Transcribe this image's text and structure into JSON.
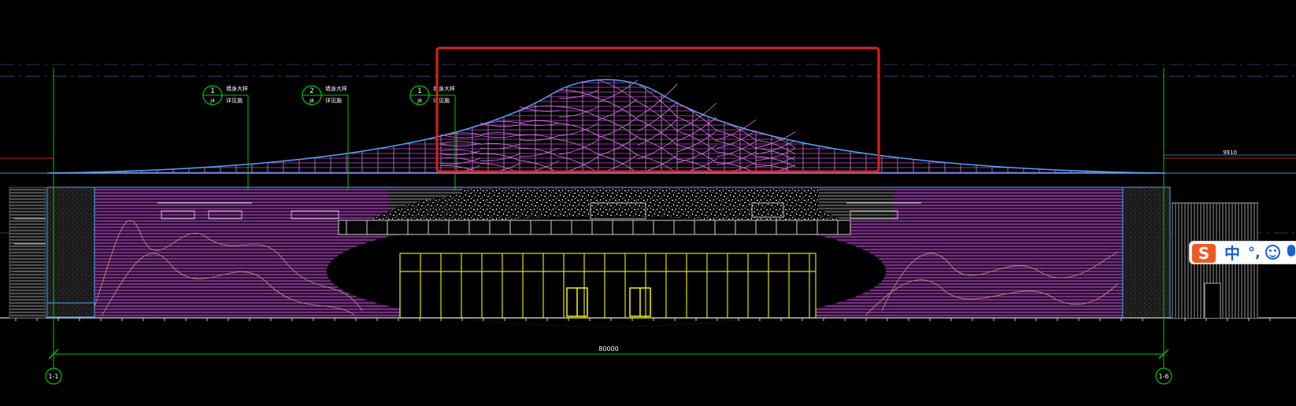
{
  "drawing": {
    "callouts": [
      {
        "num": "1",
        "sheet": "J4",
        "line1": "墙身大样",
        "line2": "详见施"
      },
      {
        "num": "2",
        "sheet": "J8",
        "line1": "墙身大样",
        "line2": "详见施"
      },
      {
        "num": "1",
        "sheet": "J8",
        "line1": "墙身大样",
        "line2": "详见施"
      }
    ],
    "dimensions": {
      "overall_width": "80000",
      "height_tag": "9910"
    },
    "grid_axes": [
      "1-1",
      "1-6"
    ],
    "colors": {
      "background": "#000000",
      "roof": "#c050d0",
      "outline": "#4da6ff",
      "leader": "#00c800",
      "highlight": "#e02020",
      "glazing": "#e0e000"
    }
  },
  "ime_toolbar": {
    "logo": "S",
    "lang": "中",
    "punct": "°,",
    "icons": [
      "emoji-icon",
      "microphone-icon"
    ]
  }
}
